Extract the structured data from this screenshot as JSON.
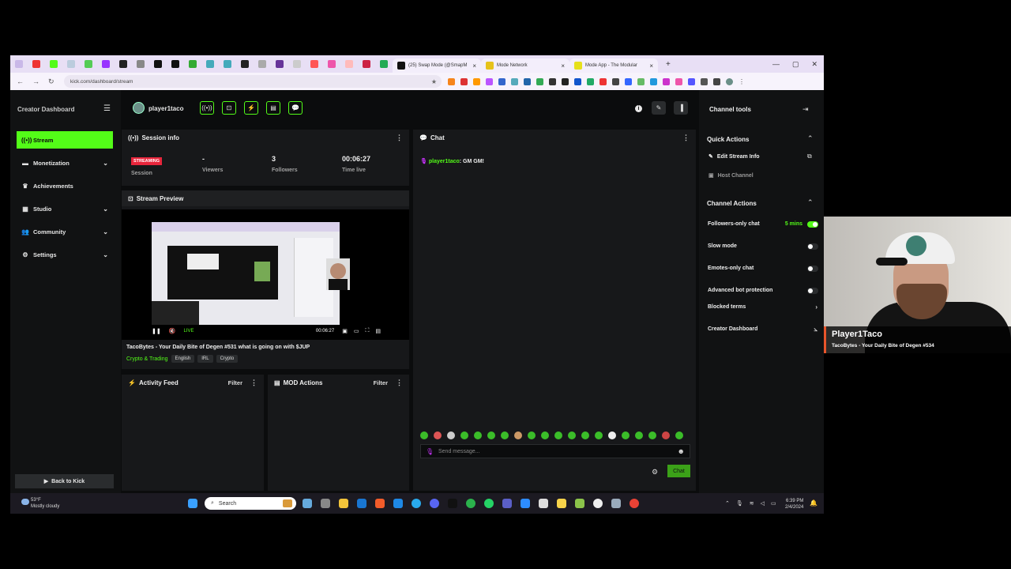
{
  "browser": {
    "tabs": [
      {
        "label": "(25) Swap Mode (@SmapM",
        "color": "#111"
      },
      {
        "label": "Mode Network",
        "color": "#e6c21a"
      },
      {
        "label": "Mode App - The Modular",
        "color": "#e6e01a"
      }
    ],
    "new_tab": "+",
    "url": "kick.com/dashboard/stream"
  },
  "sidebar": {
    "title": "Creator Dashboard",
    "items": [
      {
        "label": "Stream",
        "icon": "broadcast-icon"
      },
      {
        "label": "Monetization",
        "icon": "money-icon"
      },
      {
        "label": "Achievements",
        "icon": "trophy-icon"
      },
      {
        "label": "Studio",
        "icon": "film-icon"
      },
      {
        "label": "Community",
        "icon": "people-icon"
      },
      {
        "label": "Settings",
        "icon": "gear-icon"
      }
    ],
    "back": "Back to Kick"
  },
  "topbar": {
    "username": "player1taco"
  },
  "session": {
    "title": "Session info",
    "badge": "STREAMING",
    "session_label": "Session",
    "viewers_value": "-",
    "viewers_label": "Viewers",
    "followers_value": "3",
    "followers_label": "Followers",
    "time_value": "00:06:27",
    "time_label": "Time live"
  },
  "preview": {
    "title": "Stream Preview",
    "live": "LIVE",
    "time": "00:06:27",
    "stream_title": "TacoBytes - Your Daily Bite of Degen #531 what is going on with $JUP",
    "category": "Crypto & Trading",
    "tags": [
      "English",
      "IRL",
      "Crypto"
    ]
  },
  "activity": {
    "title": "Activity Feed",
    "filter": "Filter"
  },
  "mod": {
    "title": "MOD Actions",
    "filter": "Filter"
  },
  "chat": {
    "title": "Chat",
    "messages": [
      {
        "user": "player1taco",
        "text": "GM GM!"
      }
    ],
    "placeholder": "Send message...",
    "send": "Chat"
  },
  "tools": {
    "title": "Channel tools",
    "quick_title": "Quick Actions",
    "edit_info": "Edit Stream Info",
    "host": "Host Channel",
    "channel_title": "Channel Actions",
    "followers_only": "Followers-only chat",
    "followers_time": "5 mins",
    "slow": "Slow mode",
    "emotes": "Emotes-only chat",
    "bot": "Advanced bot protection",
    "blocked": "Blocked terms",
    "dashboard": "Creator Dashboard"
  },
  "taskbar": {
    "temp": "53°F",
    "condition": "Mostly cloudy",
    "search": "Search",
    "time": "6:39 PM",
    "date": "2/4/2024"
  },
  "webcam": {
    "name": "Player1Taco",
    "subtitle": "TacoBytes - Your Daily Bite of Degen #534"
  }
}
